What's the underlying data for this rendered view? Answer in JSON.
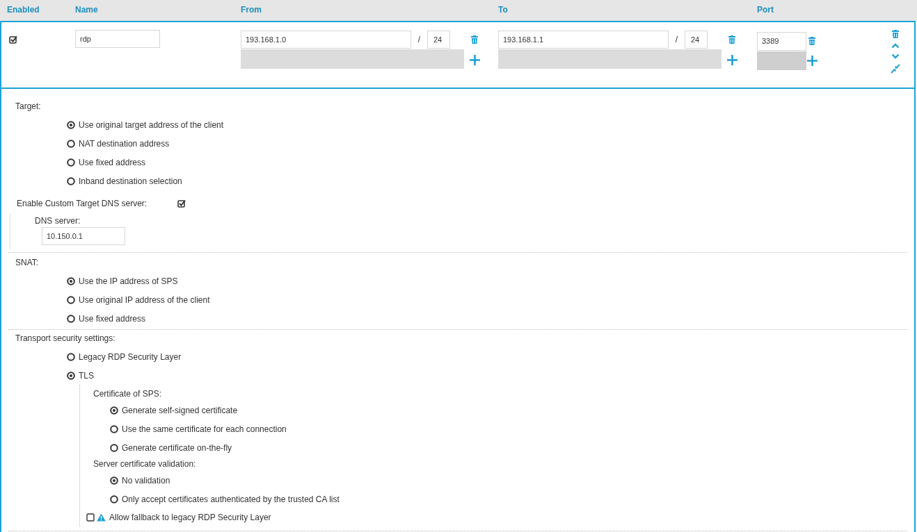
{
  "table": {
    "columns": [
      "Enabled",
      "Name",
      "From",
      "To",
      "Port"
    ],
    "rows": [
      {
        "enabled": true,
        "name": "rdp",
        "from": {
          "address": "193.168.1.0",
          "separator": "/",
          "prefix": "24"
        },
        "to": {
          "address": "193.168.1.1",
          "separator": "/",
          "prefix": "24"
        },
        "port": "3389"
      }
    ]
  },
  "details": {
    "target": {
      "label": "Target:",
      "options": [
        {
          "label": "Use original target address of the client",
          "selected": true
        },
        {
          "label": "NAT destination address",
          "selected": false
        },
        {
          "label": "Use fixed address",
          "selected": false
        },
        {
          "label": "Inband destination selection",
          "selected": false
        }
      ]
    },
    "custom_dns": {
      "label": "Enable Custom Target DNS server:",
      "checked": true,
      "server_label": "DNS server:",
      "server_value": "10.150.0.1"
    },
    "snat": {
      "label": "SNAT:",
      "options": [
        {
          "label": "Use the IP address of SPS",
          "selected": true
        },
        {
          "label": "Use original IP address of the client",
          "selected": false
        },
        {
          "label": "Use fixed address",
          "selected": false
        }
      ]
    },
    "transport": {
      "label": "Transport security settings:",
      "options": [
        {
          "label": "Legacy RDP Security Layer",
          "selected": false
        },
        {
          "label": "TLS",
          "selected": true
        }
      ],
      "certificate": {
        "label": "Certificate of SPS:",
        "options": [
          {
            "label": "Generate self-signed certificate",
            "selected": true
          },
          {
            "label": "Use the same certificate for each connection",
            "selected": false
          },
          {
            "label": "Generate certificate on-the-fly",
            "selected": false
          }
        ]
      },
      "validation": {
        "label": "Server certificate validation:",
        "options": [
          {
            "label": "No validation",
            "selected": true
          },
          {
            "label": "Only accept certificates authenticated by the trusted CA list",
            "selected": false
          }
        ]
      },
      "fallback": {
        "label": "Allow fallback to legacy RDP Security Layer",
        "checked": false
      }
    }
  }
}
